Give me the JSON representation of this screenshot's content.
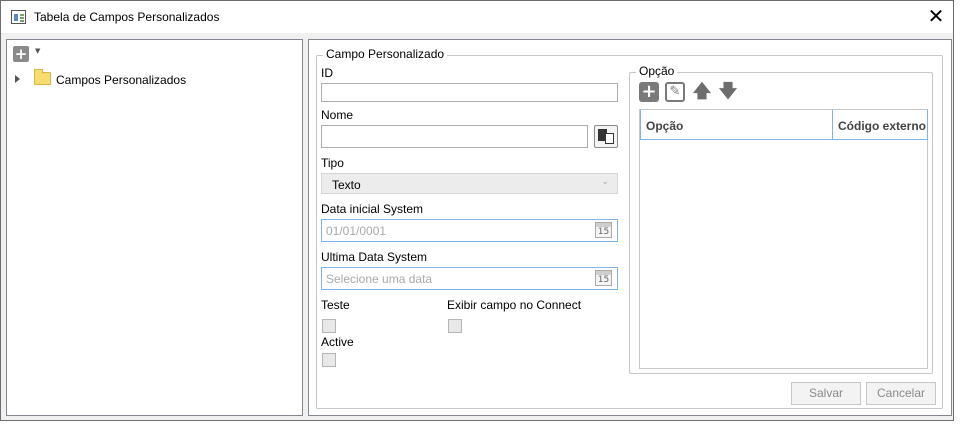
{
  "window": {
    "title": "Tabela de Campos Personalizados",
    "close_glyph": "✕"
  },
  "tree": {
    "add_glyph": "+",
    "dropdown_glyph": "▼",
    "items": [
      {
        "label": "Campos Personalizados",
        "icon": "folder-icon"
      }
    ]
  },
  "form": {
    "group_title": "Campo Personalizado",
    "id_label": "ID",
    "id_value": "",
    "nome_label": "Nome",
    "nome_value": "",
    "tipo_label": "Tipo",
    "tipo_value": "Texto",
    "data_inicial_label": "Data inicial System",
    "data_inicial_placeholder": "01/01/0001",
    "ultima_data_label": "Ultima Data System",
    "ultima_data_placeholder": "Selecione uma data",
    "calendar_day": "15",
    "teste_label": "Teste",
    "exibir_label": "Exibir campo no Connect",
    "active_label": "Active"
  },
  "options": {
    "group_title": "Opção",
    "columns": [
      "Opção",
      "Código externo"
    ],
    "rows": []
  },
  "buttons": {
    "save": "Salvar",
    "cancel": "Cancelar"
  }
}
